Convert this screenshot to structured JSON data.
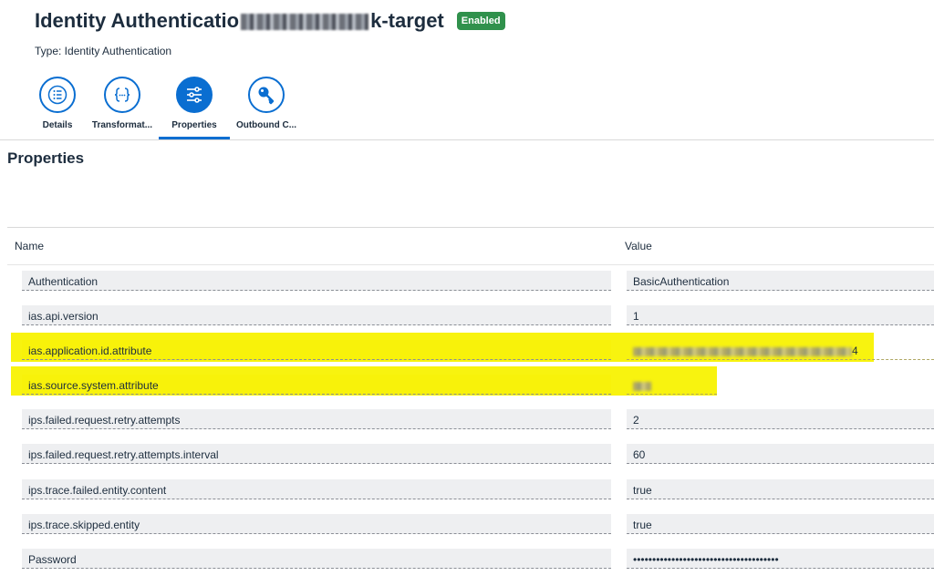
{
  "header": {
    "title_prefix": "Identity Authenticatio",
    "title_suffix": "k-target",
    "status_badge": "Enabled",
    "subtitle": "Type: Identity Authentication"
  },
  "tabs": [
    {
      "label": "Details",
      "icon": "list-icon",
      "active": false
    },
    {
      "label": "Transformat...",
      "icon": "code-braces-icon",
      "active": false
    },
    {
      "label": "Properties",
      "icon": "sliders-icon",
      "active": true
    },
    {
      "label": "Outbound C...",
      "icon": "key-icon",
      "active": false
    }
  ],
  "section_title": "Properties",
  "table": {
    "headers": {
      "name": "Name",
      "value": "Value"
    },
    "rows": [
      {
        "name": "Authentication",
        "value": "BasicAuthentication"
      },
      {
        "name": "ias.api.version",
        "value": "1"
      },
      {
        "name": "ias.application.id.attribute",
        "value": "4"
      },
      {
        "name": "ias.source.system.attribute",
        "value": ""
      },
      {
        "name": "ips.failed.request.retry.attempts",
        "value": "2"
      },
      {
        "name": "ips.failed.request.retry.attempts.interval",
        "value": "60"
      },
      {
        "name": "ips.trace.failed.entity.content",
        "value": "true"
      },
      {
        "name": "ips.trace.skipped.entity",
        "value": "true"
      },
      {
        "name": "Password",
        "value": "••••••••••••••••••••••••••••••••••••••"
      }
    ]
  },
  "colors": {
    "accent": "#0a6ed1",
    "badge": "#30914c",
    "highlight": "#f8f30f"
  }
}
